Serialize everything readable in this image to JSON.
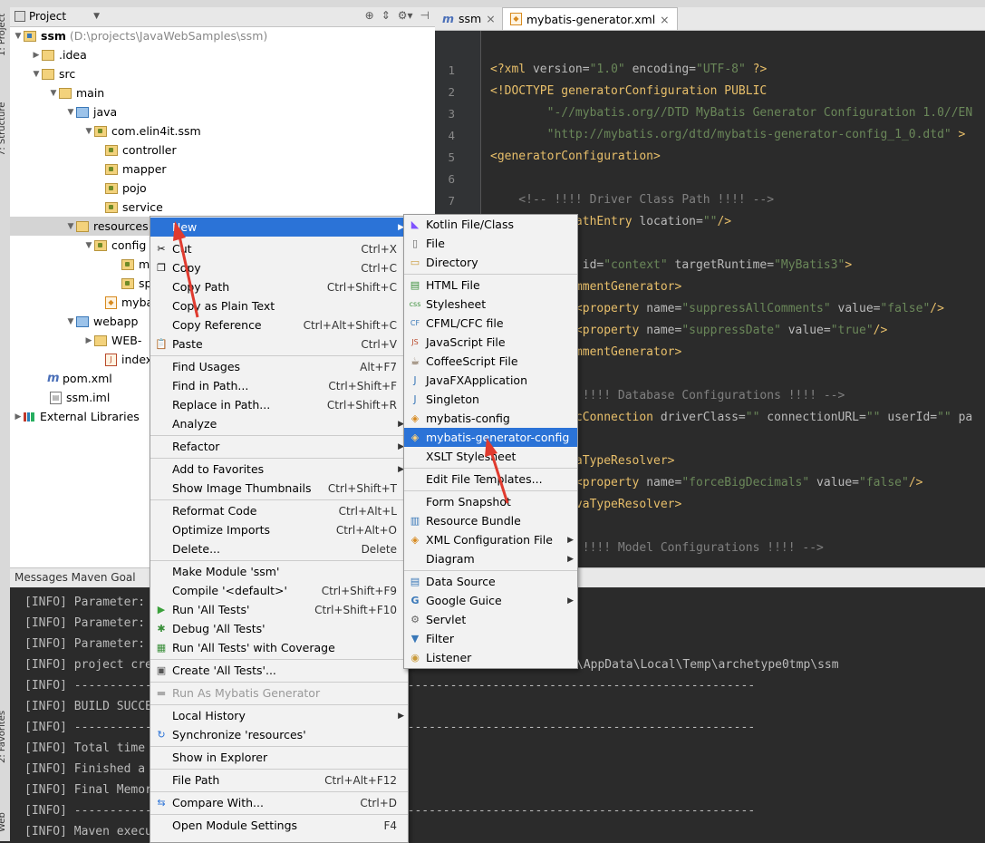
{
  "project_panel": {
    "title": "Project",
    "tree": [
      {
        "label": "ssm",
        "suffix": "(D:\\projects\\JavaWebSamples\\ssm)"
      },
      {
        "label": ".idea"
      },
      {
        "label": "src"
      },
      {
        "label": "main"
      },
      {
        "label": "java"
      },
      {
        "label": "com.elin4it.ssm"
      },
      {
        "label": "controller"
      },
      {
        "label": "mapper"
      },
      {
        "label": "pojo"
      },
      {
        "label": "service"
      },
      {
        "label": "resources"
      },
      {
        "label": "config"
      },
      {
        "label": "my"
      },
      {
        "label": "sp"
      },
      {
        "label": "mybat"
      },
      {
        "label": "webapp"
      },
      {
        "label": "WEB-"
      },
      {
        "label": "index."
      },
      {
        "label": "pom.xml"
      },
      {
        "label": "ssm.iml"
      },
      {
        "label": "External Libraries"
      }
    ]
  },
  "left_strip": {
    "project_tab": "1: Project",
    "structure_tab": "7: Structure",
    "favorites_tab": "2: Favorites",
    "web_tab": "Web"
  },
  "editor": {
    "tabs": [
      {
        "label": "ssm",
        "close": "×"
      },
      {
        "label": "mybatis-generator.xml",
        "close": "×"
      }
    ],
    "line_numbers": [
      "1",
      "2",
      "3",
      "4",
      "5",
      "6",
      "7"
    ]
  },
  "bottom_panel": {
    "title": "Messages Maven Goal",
    "lines": [
      "[INFO] Parameter:",
      "[INFO] Parameter:",
      "[INFO] Parameter:",
      "[INFO] project cre",
      "[INFO] ------------------------------------------------------------------------------------------------",
      "[INFO] BUILD SUCCE",
      "[INFO] ------------------------------------------------------------------------------------------------",
      "[INFO] Total time",
      "[INFO] Finished a",
      "[INFO] Final Memor",
      "[INFO] ------------------------------------------------------------------------------------------------",
      "[INFO] Maven execu"
    ],
    "path_fragment": "\\AppData\\Local\\Temp\\archetype0tmp\\ssm"
  },
  "context_menu": {
    "items": [
      {
        "label": "New",
        "shortcut": "",
        "submenu": true
      },
      {
        "label": "Cut",
        "shortcut": "Ctrl+X"
      },
      {
        "label": "Copy",
        "shortcut": "Ctrl+C"
      },
      {
        "label": "Copy Path",
        "shortcut": "Ctrl+Shift+C"
      },
      {
        "label": "Copy as Plain Text",
        "shortcut": ""
      },
      {
        "label": "Copy Reference",
        "shortcut": "Ctrl+Alt+Shift+C"
      },
      {
        "label": "Paste",
        "shortcut": "Ctrl+V"
      },
      {
        "label": "Find Usages",
        "shortcut": "Alt+F7"
      },
      {
        "label": "Find in Path...",
        "shortcut": "Ctrl+Shift+F"
      },
      {
        "label": "Replace in Path...",
        "shortcut": "Ctrl+Shift+R"
      },
      {
        "label": "Analyze",
        "shortcut": "",
        "submenu": true
      },
      {
        "label": "Refactor",
        "shortcut": "",
        "submenu": true
      },
      {
        "label": "Add to Favorites",
        "shortcut": "",
        "submenu": true
      },
      {
        "label": "Show Image Thumbnails",
        "shortcut": "Ctrl+Shift+T"
      },
      {
        "label": "Reformat Code",
        "shortcut": "Ctrl+Alt+L"
      },
      {
        "label": "Optimize Imports",
        "shortcut": "Ctrl+Alt+O"
      },
      {
        "label": "Delete...",
        "shortcut": "Delete"
      },
      {
        "label": "Make Module 'ssm'",
        "shortcut": ""
      },
      {
        "label": "Compile '<default>'",
        "shortcut": "Ctrl+Shift+F9"
      },
      {
        "label": "Run 'All Tests'",
        "shortcut": "Ctrl+Shift+F10"
      },
      {
        "label": "Debug 'All Tests'",
        "shortcut": ""
      },
      {
        "label": "Run 'All Tests' with Coverage",
        "shortcut": ""
      },
      {
        "label": "Create 'All Tests'...",
        "shortcut": ""
      },
      {
        "label": "Run As Mybatis Generator",
        "shortcut": ""
      },
      {
        "label": "Local History",
        "shortcut": "",
        "submenu": true
      },
      {
        "label": "Synchronize 'resources'",
        "shortcut": ""
      },
      {
        "label": "Show in Explorer",
        "shortcut": ""
      },
      {
        "label": "File Path",
        "shortcut": "Ctrl+Alt+F12"
      },
      {
        "label": "Compare With...",
        "shortcut": "Ctrl+D"
      },
      {
        "label": "Open Module Settings",
        "shortcut": "F4"
      }
    ]
  },
  "new_submenu": {
    "items": [
      {
        "label": "Kotlin File/Class"
      },
      {
        "label": "File"
      },
      {
        "label": "Directory"
      },
      {
        "label": "HTML File"
      },
      {
        "label": "Stylesheet"
      },
      {
        "label": "CFML/CFC file"
      },
      {
        "label": "JavaScript File"
      },
      {
        "label": "CoffeeScript File"
      },
      {
        "label": "JavaFXApplication"
      },
      {
        "label": "Singleton"
      },
      {
        "label": "mybatis-config"
      },
      {
        "label": "mybatis-generator-config"
      },
      {
        "label": "XSLT Stylesheet"
      },
      {
        "label": "Edit File Templates..."
      },
      {
        "label": "Form Snapshot"
      },
      {
        "label": "Resource Bundle"
      },
      {
        "label": "XML Configuration File"
      },
      {
        "label": "Diagram"
      },
      {
        "label": "Data Source"
      },
      {
        "label": "Google Guice"
      },
      {
        "label": "Servlet"
      },
      {
        "label": "Filter"
      },
      {
        "label": "Listener"
      }
    ]
  },
  "colors": {
    "selection": "#2b73d7",
    "annotation_arrow": "#e03b2f",
    "editor_bg": "#2b2b2b"
  }
}
